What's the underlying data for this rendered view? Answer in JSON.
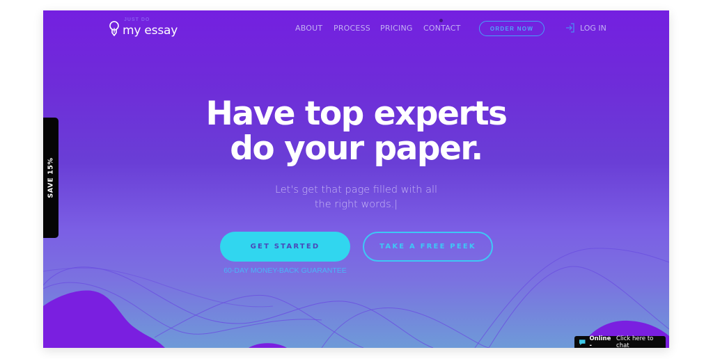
{
  "brand": {
    "small_text": "JUST DO",
    "name": "my essay",
    "icon": "lightbulb-pen-icon"
  },
  "nav": {
    "items": [
      {
        "label": "ABOUT"
      },
      {
        "label": "PROCESS"
      },
      {
        "label": "PRICING"
      },
      {
        "label": "CONTACT"
      }
    ],
    "order_button": "ORDER NOW",
    "login": {
      "label": "LOG IN",
      "icon": "login-arrow-icon"
    }
  },
  "hero": {
    "headline_line1": "Have top experts",
    "headline_line2": "do your paper.",
    "subline_line1": "Let's get that page filled with all",
    "subline_line2": "the right words.|",
    "primary_button": "GET STARTED",
    "secondary_button": "TAKE A FREE PEEK",
    "guarantee": "60-DAY MONEY-BACK GUARANTEE"
  },
  "save_tab": {
    "label": "SAVE 15%"
  },
  "chat": {
    "status": "Online -",
    "cta": "Click here to chat",
    "icon": "speech-bubble-icon"
  },
  "colors": {
    "background_top": "#7420e0",
    "background_bottom": "#6e9ad8",
    "accent_cyan": "#31d6ef",
    "accent_blue": "#45a2f7",
    "blob_purple": "#7a1fe0"
  }
}
